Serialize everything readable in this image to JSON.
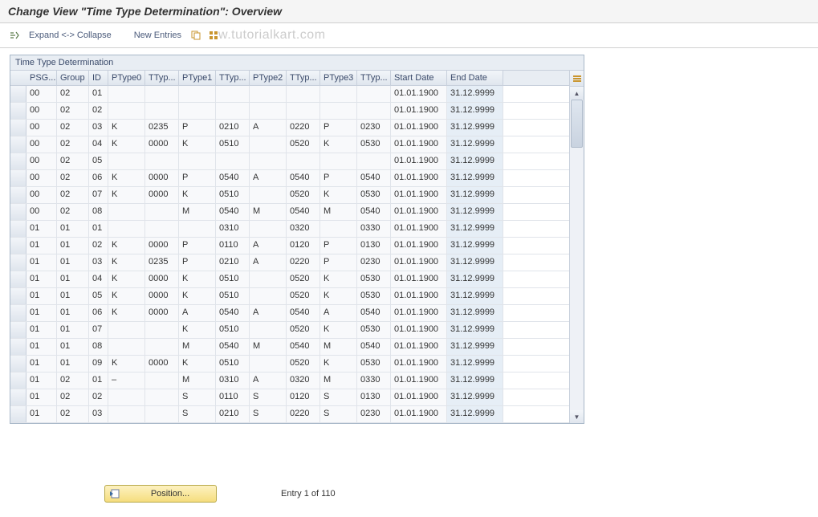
{
  "title": "Change View \"Time Type Determination\": Overview",
  "toolbar": {
    "expand_collapse": "Expand <-> Collapse",
    "new_entries": "New Entries"
  },
  "watermark": "w.tutorialkart.com",
  "table": {
    "title": "Time Type Determination",
    "columns": [
      "PSG...",
      "Group",
      "ID",
      "PType0",
      "TTyp...",
      "PType1",
      "TTyp...",
      "PType2",
      "TTyp...",
      "PType3",
      "TTyp...",
      "Start Date",
      "End Date"
    ],
    "rows": [
      {
        "psg": "00",
        "group": "02",
        "id": "01",
        "pt0": "",
        "tt0": "",
        "pt1": "",
        "tt1": "",
        "pt2": "",
        "tt2": "",
        "pt3": "",
        "tt3": "",
        "sd": "01.01.1900",
        "ed": "31.12.9999"
      },
      {
        "psg": "00",
        "group": "02",
        "id": "02",
        "pt0": "",
        "tt0": "",
        "pt1": "",
        "tt1": "",
        "pt2": "",
        "tt2": "",
        "pt3": "",
        "tt3": "",
        "sd": "01.01.1900",
        "ed": "31.12.9999"
      },
      {
        "psg": "00",
        "group": "02",
        "id": "03",
        "pt0": "K",
        "tt0": "0235",
        "pt1": "P",
        "tt1": "0210",
        "pt2": "A",
        "tt2": "0220",
        "pt3": "P",
        "tt3": "0230",
        "sd": "01.01.1900",
        "ed": "31.12.9999"
      },
      {
        "psg": "00",
        "group": "02",
        "id": "04",
        "pt0": "K",
        "tt0": "0000",
        "pt1": "K",
        "tt1": "0510",
        "pt2": "",
        "tt2": "0520",
        "pt3": "K",
        "tt3": "0530",
        "sd": "01.01.1900",
        "ed": "31.12.9999"
      },
      {
        "psg": "00",
        "group": "02",
        "id": "05",
        "pt0": "",
        "tt0": "",
        "pt1": "",
        "tt1": "",
        "pt2": "",
        "tt2": "",
        "pt3": "",
        "tt3": "",
        "sd": "01.01.1900",
        "ed": "31.12.9999"
      },
      {
        "psg": "00",
        "group": "02",
        "id": "06",
        "pt0": "K",
        "tt0": "0000",
        "pt1": "P",
        "tt1": "0540",
        "pt2": "A",
        "tt2": "0540",
        "pt3": "P",
        "tt3": "0540",
        "sd": "01.01.1900",
        "ed": "31.12.9999"
      },
      {
        "psg": "00",
        "group": "02",
        "id": "07",
        "pt0": "K",
        "tt0": "0000",
        "pt1": "K",
        "tt1": "0510",
        "pt2": "",
        "tt2": "0520",
        "pt3": "K",
        "tt3": "0530",
        "sd": "01.01.1900",
        "ed": "31.12.9999"
      },
      {
        "psg": "00",
        "group": "02",
        "id": "08",
        "pt0": "",
        "tt0": "",
        "pt1": "M",
        "tt1": "0540",
        "pt2": "M",
        "tt2": "0540",
        "pt3": "M",
        "tt3": "0540",
        "sd": "01.01.1900",
        "ed": "31.12.9999"
      },
      {
        "psg": "01",
        "group": "01",
        "id": "01",
        "pt0": "",
        "tt0": "",
        "pt1": "",
        "tt1": "0310",
        "pt2": "",
        "tt2": "0320",
        "pt3": "",
        "tt3": "0330",
        "sd": "01.01.1900",
        "ed": "31.12.9999"
      },
      {
        "psg": "01",
        "group": "01",
        "id": "02",
        "pt0": "K",
        "tt0": "0000",
        "pt1": "P",
        "tt1": "0110",
        "pt2": "A",
        "tt2": "0120",
        "pt3": "P",
        "tt3": "0130",
        "sd": "01.01.1900",
        "ed": "31.12.9999"
      },
      {
        "psg": "01",
        "group": "01",
        "id": "03",
        "pt0": "K",
        "tt0": "0235",
        "pt1": "P",
        "tt1": "0210",
        "pt2": "A",
        "tt2": "0220",
        "pt3": "P",
        "tt3": "0230",
        "sd": "01.01.1900",
        "ed": "31.12.9999"
      },
      {
        "psg": "01",
        "group": "01",
        "id": "04",
        "pt0": "K",
        "tt0": "0000",
        "pt1": "K",
        "tt1": "0510",
        "pt2": "",
        "tt2": "0520",
        "pt3": "K",
        "tt3": "0530",
        "sd": "01.01.1900",
        "ed": "31.12.9999"
      },
      {
        "psg": "01",
        "group": "01",
        "id": "05",
        "pt0": "K",
        "tt0": "0000",
        "pt1": "K",
        "tt1": "0510",
        "pt2": "",
        "tt2": "0520",
        "pt3": "K",
        "tt3": "0530",
        "sd": "01.01.1900",
        "ed": "31.12.9999"
      },
      {
        "psg": "01",
        "group": "01",
        "id": "06",
        "pt0": "K",
        "tt0": "0000",
        "pt1": "A",
        "tt1": "0540",
        "pt2": "A",
        "tt2": "0540",
        "pt3": "A",
        "tt3": "0540",
        "sd": "01.01.1900",
        "ed": "31.12.9999"
      },
      {
        "psg": "01",
        "group": "01",
        "id": "07",
        "pt0": "",
        "tt0": "",
        "pt1": "K",
        "tt1": "0510",
        "pt2": "",
        "tt2": "0520",
        "pt3": "K",
        "tt3": "0530",
        "sd": "01.01.1900",
        "ed": "31.12.9999"
      },
      {
        "psg": "01",
        "group": "01",
        "id": "08",
        "pt0": "",
        "tt0": "",
        "pt1": "M",
        "tt1": "0540",
        "pt2": "M",
        "tt2": "0540",
        "pt3": "M",
        "tt3": "0540",
        "sd": "01.01.1900",
        "ed": "31.12.9999"
      },
      {
        "psg": "01",
        "group": "01",
        "id": "09",
        "pt0": "K",
        "tt0": "0000",
        "pt1": "K",
        "tt1": "0510",
        "pt2": "",
        "tt2": "0520",
        "pt3": "K",
        "tt3": "0530",
        "sd": "01.01.1900",
        "ed": "31.12.9999"
      },
      {
        "psg": "01",
        "group": "02",
        "id": "01",
        "pt0": "–",
        "tt0": "",
        "pt1": "M",
        "tt1": "0310",
        "pt2": "A",
        "tt2": "0320",
        "pt3": "M",
        "tt3": "0330",
        "sd": "01.01.1900",
        "ed": "31.12.9999"
      },
      {
        "psg": "01",
        "group": "02",
        "id": "02",
        "pt0": "",
        "tt0": "",
        "pt1": "S",
        "tt1": "0110",
        "pt2": "S",
        "tt2": "0120",
        "pt3": "S",
        "tt3": "0130",
        "sd": "01.01.1900",
        "ed": "31.12.9999"
      },
      {
        "psg": "01",
        "group": "02",
        "id": "03",
        "pt0": "",
        "tt0": "",
        "pt1": "S",
        "tt1": "0210",
        "pt2": "S",
        "tt2": "0220",
        "pt3": "S",
        "tt3": "0230",
        "sd": "01.01.1900",
        "ed": "31.12.9999"
      }
    ]
  },
  "footer": {
    "position_label": "Position...",
    "entry_text": "Entry 1 of 110"
  }
}
